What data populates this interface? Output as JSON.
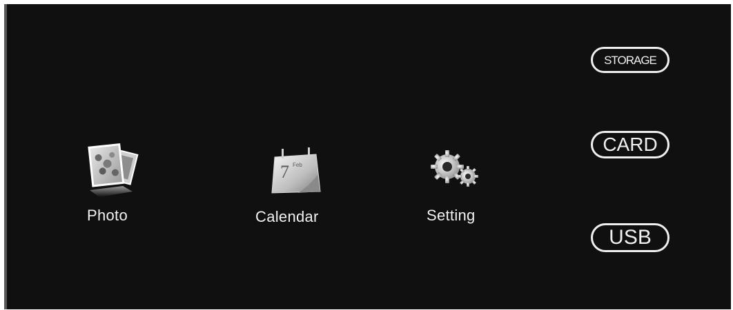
{
  "menu": {
    "items": [
      {
        "label": "Photo",
        "icon": "photo-icon"
      },
      {
        "label": "Calendar",
        "icon": "calendar-icon",
        "icon_text_day": "7",
        "icon_text_month": "Feb"
      },
      {
        "label": "Setting",
        "icon": "gear-icon"
      }
    ]
  },
  "sources": {
    "storage_label": "STORAGE",
    "card_label": "CARD",
    "usb_label": "USB"
  },
  "colors": {
    "background": "#101010",
    "text": "#f0f0f0"
  }
}
